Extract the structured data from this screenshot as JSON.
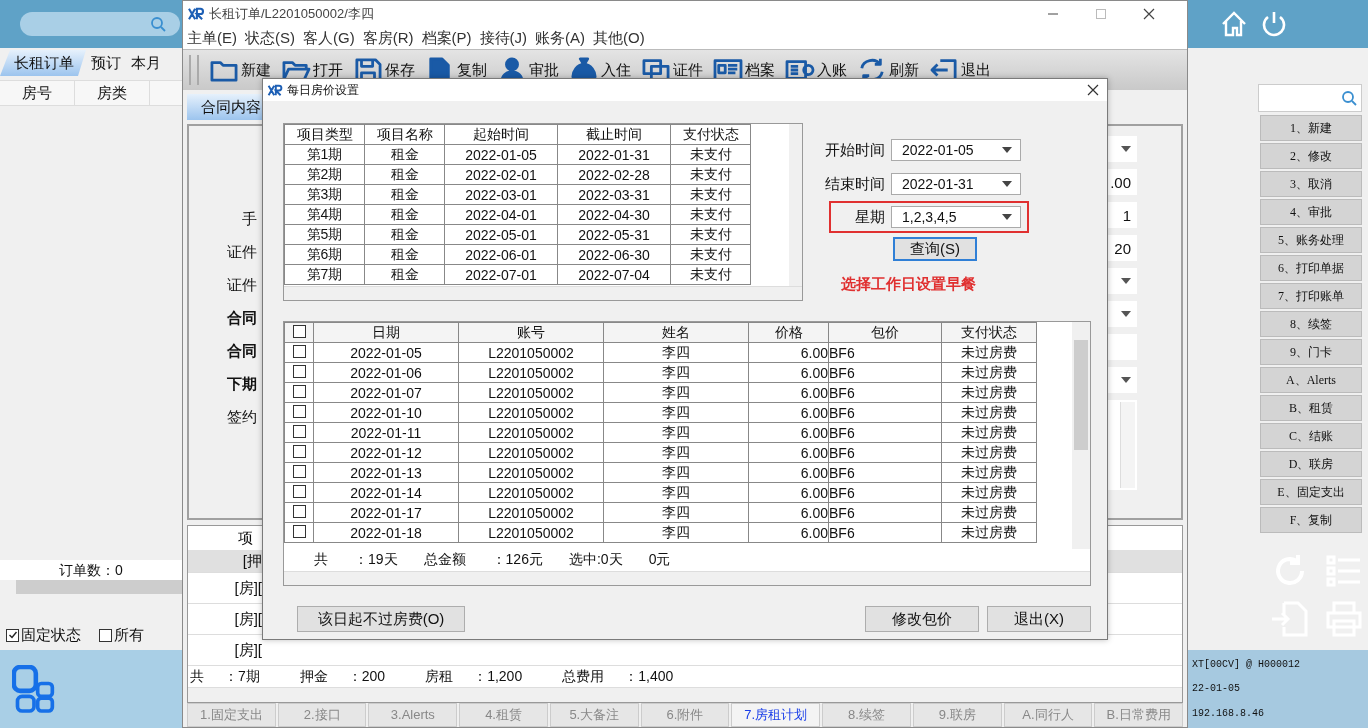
{
  "background_app": {
    "tabs": [
      {
        "label": "长租订单",
        "selected": true
      },
      {
        "label": "预订",
        "selected": false
      },
      {
        "label": "本月",
        "selected": false
      }
    ],
    "columns": [
      "房号",
      "房类"
    ],
    "order_count": "订单数：0",
    "filters": [
      {
        "label": "固定状态",
        "checked": true
      },
      {
        "label": "所有",
        "checked": false
      }
    ],
    "actions": [
      "1、新建",
      "2、修改",
      "3、取消",
      "4、审批",
      "5、账务处理",
      "6、打印单据",
      "7、打印账单",
      "8、续签",
      "9、门卡",
      "A、Alerts",
      "B、租赁",
      "C、结账",
      "D、联房",
      "E、固定支出",
      "F、复制"
    ],
    "status_lines": [
      "XT[00CV] @ H000012",
      "22-01-05",
      "192.168.8.46"
    ]
  },
  "window": {
    "title": "长租订单/L2201050002/李四",
    "menu": [
      "主单(E)",
      "状态(S)",
      "客人(G)",
      "客房(R)",
      "档案(P)",
      "接待(J)",
      "账务(A)",
      "其他(O)"
    ],
    "toolbar": [
      "新建",
      "打开",
      "保存",
      "复制",
      "审批",
      "入住",
      "证件",
      "档案",
      "入账",
      "刷新",
      "退出"
    ],
    "tab": "合同内容",
    "form_labels": [
      {
        "text": "手",
        "bold": false
      },
      {
        "text": "证件",
        "bold": false
      },
      {
        "text": "证件",
        "bold": false
      },
      {
        "text": "合同",
        "bold": true
      },
      {
        "text": "合同",
        "bold": true
      },
      {
        "text": "下期",
        "bold": true
      },
      {
        "text": "签约",
        "bold": false
      }
    ],
    "form_fields": [
      {
        "kind": "dropdown"
      },
      {
        "kind": "text",
        "value": ".00"
      },
      {
        "kind": "text",
        "value": "1"
      },
      {
        "kind": "text",
        "value": "20"
      },
      {
        "kind": "dropdown"
      },
      {
        "kind": "dropdown"
      },
      {
        "kind": "blank"
      },
      {
        "kind": "dropdown"
      },
      {
        "kind": "textarea"
      }
    ],
    "fee_table": {
      "header": "项",
      "rows": [
        {
          "text": "[押",
          "kind": "group"
        },
        {
          "text": "[房][",
          "kind": "item"
        },
        {
          "text": "[房][",
          "kind": "item"
        },
        {
          "text": "[房][",
          "kind": "item"
        }
      ]
    },
    "summary": [
      {
        "label": "共",
        "value": "：7期"
      },
      {
        "label": "押金",
        "value": "：200"
      },
      {
        "label": "房租",
        "value": "：1,200"
      },
      {
        "label": "总费用",
        "value": "：1,400"
      }
    ],
    "bottom_tabs": [
      {
        "label": "1.固定支出",
        "selected": false
      },
      {
        "label": "2.接口",
        "selected": false
      },
      {
        "label": "3.Alerts",
        "selected": false
      },
      {
        "label": "4.租赁",
        "selected": false
      },
      {
        "label": "5.大备注",
        "selected": false
      },
      {
        "label": "6.附件",
        "selected": false
      },
      {
        "label": "7.房租计划",
        "selected": true
      },
      {
        "label": "8.续签",
        "selected": false
      },
      {
        "label": "9.联房",
        "selected": false
      },
      {
        "label": "A.同行人",
        "selected": false
      },
      {
        "label": "B.日常费用",
        "selected": false
      }
    ]
  },
  "dialog": {
    "title": "每日房价设置",
    "periods": {
      "columns": [
        "项目类型",
        "项目名称",
        "起始时间",
        "截止时间",
        "支付状态"
      ],
      "rows": [
        [
          "第1期",
          "租金",
          "2022-01-05",
          "2022-01-31",
          "未支付"
        ],
        [
          "第2期",
          "租金",
          "2022-02-01",
          "2022-02-28",
          "未支付"
        ],
        [
          "第3期",
          "租金",
          "2022-03-01",
          "2022-03-31",
          "未支付"
        ],
        [
          "第4期",
          "租金",
          "2022-04-01",
          "2022-04-30",
          "未支付"
        ],
        [
          "第5期",
          "租金",
          "2022-05-01",
          "2022-05-31",
          "未支付"
        ],
        [
          "第6期",
          "租金",
          "2022-06-01",
          "2022-06-30",
          "未支付"
        ],
        [
          "第7期",
          "租金",
          "2022-07-01",
          "2022-07-04",
          "未支付"
        ]
      ]
    },
    "filters": [
      {
        "label": "开始时间",
        "value": "2022-01-05",
        "highlighted": false
      },
      {
        "label": "结束时间",
        "value": "2022-01-31",
        "highlighted": false
      },
      {
        "label": "星期",
        "value": "1,2,3,4,5",
        "highlighted": true
      }
    ],
    "query_button": {
      "label": "查询(S)",
      "focused": true
    },
    "note": "选择工作日设置早餐",
    "days": {
      "all_checked": false,
      "columns": [
        "日期",
        "账号",
        "姓名",
        "价格",
        "包价",
        "支付状态"
      ],
      "rows": [
        {
          "checked": false,
          "date": "2022-01-05",
          "account": "L2201050002",
          "name": "李四",
          "price": "6.00",
          "package": "BF6",
          "status": "未过房费"
        },
        {
          "checked": false,
          "date": "2022-01-06",
          "account": "L2201050002",
          "name": "李四",
          "price": "6.00",
          "package": "BF6",
          "status": "未过房费"
        },
        {
          "checked": false,
          "date": "2022-01-07",
          "account": "L2201050002",
          "name": "李四",
          "price": "6.00",
          "package": "BF6",
          "status": "未过房费"
        },
        {
          "checked": false,
          "date": "2022-01-10",
          "account": "L2201050002",
          "name": "李四",
          "price": "6.00",
          "package": "BF6",
          "status": "未过房费"
        },
        {
          "checked": false,
          "date": "2022-01-11",
          "account": "L2201050002",
          "name": "李四",
          "price": "6.00",
          "package": "BF6",
          "status": "未过房费"
        },
        {
          "checked": false,
          "date": "2022-01-12",
          "account": "L2201050002",
          "name": "李四",
          "price": "6.00",
          "package": "BF6",
          "status": "未过房费"
        },
        {
          "checked": false,
          "date": "2022-01-13",
          "account": "L2201050002",
          "name": "李四",
          "price": "6.00",
          "package": "BF6",
          "status": "未过房费"
        },
        {
          "checked": false,
          "date": "2022-01-14",
          "account": "L2201050002",
          "name": "李四",
          "price": "6.00",
          "package": "BF6",
          "status": "未过房费"
        },
        {
          "checked": false,
          "date": "2022-01-17",
          "account": "L2201050002",
          "name": "李四",
          "price": "6.00",
          "package": "BF6",
          "status": "未过房费"
        },
        {
          "checked": false,
          "date": "2022-01-18",
          "account": "L2201050002",
          "name": "李四",
          "price": "6.00",
          "package": "BF6",
          "status": "未过房费"
        }
      ],
      "footer": [
        "共",
        "：19天",
        "总金额",
        "：126元",
        "选中:0天",
        "0元"
      ]
    },
    "buttons": [
      "该日起不过房费(O)",
      "修改包价",
      "退出(X)"
    ]
  }
}
